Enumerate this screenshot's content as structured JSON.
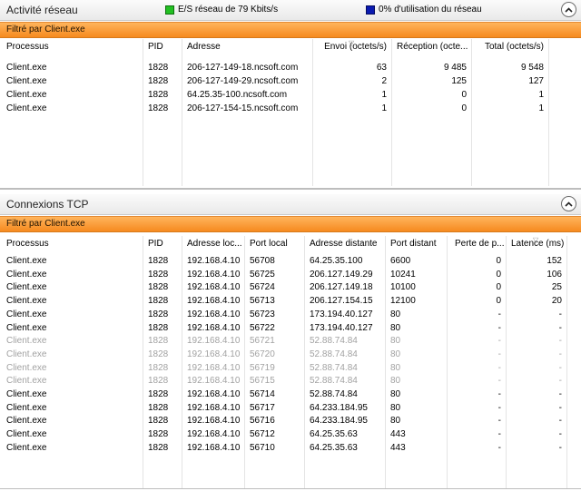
{
  "network_panel": {
    "title": "Activité réseau",
    "legend": [
      {
        "label": "E/S réseau de 79 Kbits/s",
        "color": "#22c022"
      },
      {
        "label": "0% d'utilisation du réseau",
        "color": "#0a1ab0"
      }
    ],
    "filter_label": "Filtré par Client.exe",
    "columns": [
      "Processus",
      "PID",
      "Adresse",
      "Envoi (octets/s)",
      "Réception (octe...",
      "Total (octets/s)"
    ],
    "rows": [
      [
        "Client.exe",
        "1828",
        "206-127-149-18.ncsoft.com",
        "63",
        "9 485",
        "9 548"
      ],
      [
        "Client.exe",
        "1828",
        "206-127-149-29.ncsoft.com",
        "2",
        "125",
        "127"
      ],
      [
        "Client.exe",
        "1828",
        "64.25.35-100.ncsoft.com",
        "1",
        "0",
        "1"
      ],
      [
        "Client.exe",
        "1828",
        "206-127-154-15.ncsoft.com",
        "1",
        "0",
        "1"
      ]
    ]
  },
  "tcp_panel": {
    "title": "Connexions TCP",
    "filter_label": "Filtré par Client.exe",
    "columns": [
      "Processus",
      "PID",
      "Adresse loc...",
      "Port local",
      "Adresse distante",
      "Port distant",
      "Perte de p...",
      "Latence (ms)"
    ],
    "rows": [
      {
        "dim": false,
        "cells": [
          "Client.exe",
          "1828",
          "192.168.4.10",
          "56708",
          "64.25.35.100",
          "6600",
          "0",
          "152"
        ]
      },
      {
        "dim": false,
        "cells": [
          "Client.exe",
          "1828",
          "192.168.4.10",
          "56725",
          "206.127.149.29",
          "10241",
          "0",
          "106"
        ]
      },
      {
        "dim": false,
        "cells": [
          "Client.exe",
          "1828",
          "192.168.4.10",
          "56724",
          "206.127.149.18",
          "10100",
          "0",
          "25"
        ]
      },
      {
        "dim": false,
        "cells": [
          "Client.exe",
          "1828",
          "192.168.4.10",
          "56713",
          "206.127.154.15",
          "12100",
          "0",
          "20"
        ]
      },
      {
        "dim": false,
        "cells": [
          "Client.exe",
          "1828",
          "192.168.4.10",
          "56723",
          "173.194.40.127",
          "80",
          "-",
          "-"
        ]
      },
      {
        "dim": false,
        "cells": [
          "Client.exe",
          "1828",
          "192.168.4.10",
          "56722",
          "173.194.40.127",
          "80",
          "-",
          "-"
        ]
      },
      {
        "dim": true,
        "cells": [
          "Client.exe",
          "1828",
          "192.168.4.10",
          "56721",
          "52.88.74.84",
          "80",
          "-",
          "-"
        ]
      },
      {
        "dim": true,
        "cells": [
          "Client.exe",
          "1828",
          "192.168.4.10",
          "56720",
          "52.88.74.84",
          "80",
          "-",
          "-"
        ]
      },
      {
        "dim": true,
        "cells": [
          "Client.exe",
          "1828",
          "192.168.4.10",
          "56719",
          "52.88.74.84",
          "80",
          "-",
          "-"
        ]
      },
      {
        "dim": true,
        "cells": [
          "Client.exe",
          "1828",
          "192.168.4.10",
          "56715",
          "52.88.74.84",
          "80",
          "-",
          "-"
        ]
      },
      {
        "dim": false,
        "cells": [
          "Client.exe",
          "1828",
          "192.168.4.10",
          "56714",
          "52.88.74.84",
          "80",
          "-",
          "-"
        ]
      },
      {
        "dim": false,
        "cells": [
          "Client.exe",
          "1828",
          "192.168.4.10",
          "56717",
          "64.233.184.95",
          "80",
          "-",
          "-"
        ]
      },
      {
        "dim": false,
        "cells": [
          "Client.exe",
          "1828",
          "192.168.4.10",
          "56716",
          "64.233.184.95",
          "80",
          "-",
          "-"
        ]
      },
      {
        "dim": false,
        "cells": [
          "Client.exe",
          "1828",
          "192.168.4.10",
          "56712",
          "64.25.35.63",
          "443",
          "-",
          "-"
        ]
      },
      {
        "dim": false,
        "cells": [
          "Client.exe",
          "1828",
          "192.168.4.10",
          "56710",
          "64.25.35.63",
          "443",
          "-",
          "-"
        ]
      }
    ]
  },
  "icons": {
    "collapse": "chevron-up-icon",
    "sort": "sort-descending-icon"
  }
}
